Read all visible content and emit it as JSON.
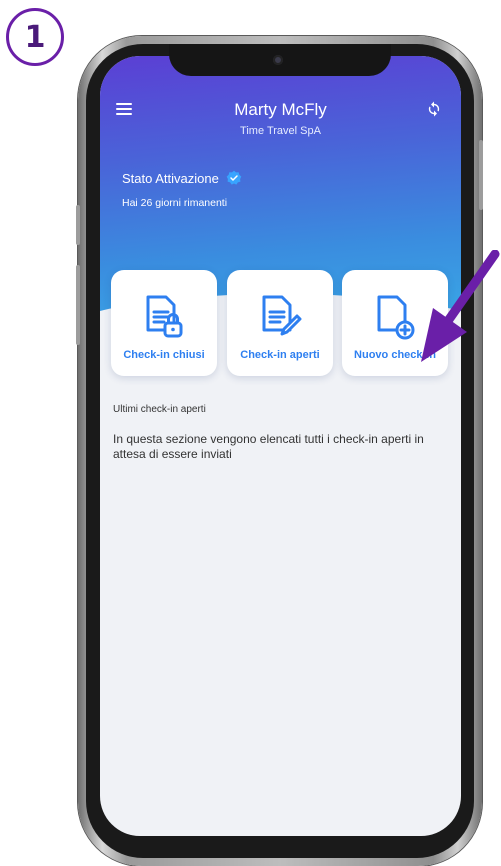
{
  "step_number": "1",
  "header": {
    "user_name": "Marty McFly",
    "company": "Time Travel SpA",
    "menu_icon": "hamburger-menu-icon",
    "sync_icon": "sync-icon"
  },
  "activation": {
    "title": "Stato Attivazione",
    "days_remaining": "Hai 26 giorni rimanenti"
  },
  "actions": [
    {
      "label": "Check-in chiusi",
      "icon": "document-lock-icon"
    },
    {
      "label": "Check-in aperti",
      "icon": "document-edit-icon"
    },
    {
      "label": "Nuovo check-in",
      "icon": "document-add-icon"
    }
  ],
  "open_checkins": {
    "title": "Ultimi check-in aperti",
    "description": "In questa sezione vengono elencati tutti i check-in aperti in attesa di essere inviati"
  },
  "colors": {
    "accent": "#2e7ff0",
    "gradient_top": "#5b3fd4",
    "gradient_bottom": "#39a9e6",
    "pointer_arrow": "#6a1fa8"
  }
}
